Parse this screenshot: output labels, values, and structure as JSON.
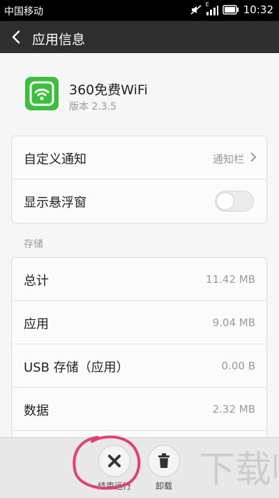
{
  "status_bar": {
    "carrier": "中国移动",
    "signal_label": "E",
    "time": "10:32"
  },
  "header": {
    "title": "应用信息"
  },
  "app": {
    "name": "360免费WiFi",
    "version": "版本 2.3.5",
    "icon_color": "#3cbf3c"
  },
  "settings": [
    {
      "label": "自定义通知",
      "value": "通知栏"
    },
    {
      "label": "显示悬浮窗",
      "toggle": false
    }
  ],
  "storage": {
    "section_label": "存储",
    "rows": [
      {
        "label": "总计",
        "value": "11.42 MB"
      },
      {
        "label": "应用",
        "value": "9.04 MB"
      },
      {
        "label": "USB 存储（应用）",
        "value": "0.00 B"
      },
      {
        "label": "数据",
        "value": "2.32 MB"
      }
    ]
  },
  "actions": {
    "stop_label": "结束运行",
    "uninstall_label": "卸载"
  },
  "watermark": {
    "text": "下载吧"
  },
  "colors": {
    "annotation": "#e0407a",
    "header_bg": "#2f2f2f",
    "accent_green": "#3cbf3c"
  }
}
